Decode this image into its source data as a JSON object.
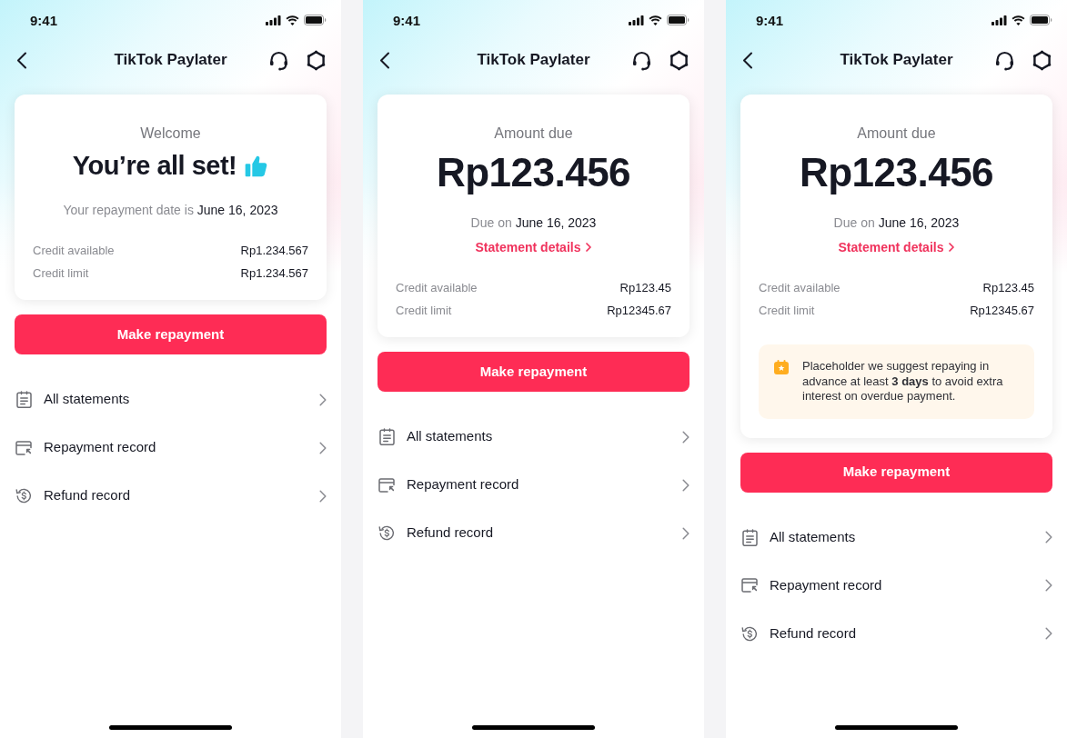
{
  "screens": [
    {
      "status_bar": {
        "time": "9:41"
      },
      "header": {
        "title": "TikTok Paylater"
      },
      "summary_card": {
        "kind": "welcome",
        "eyebrow": "Welcome",
        "headline": "You’re all set!",
        "date_label": "Your repayment date is",
        "date": "June 16, 2023",
        "rows": [
          {
            "label": "Credit available",
            "value": "Rp1.234.567"
          },
          {
            "label": "Credit limit",
            "value": "Rp1.234.567"
          }
        ]
      },
      "primary_button": "Make repayment",
      "menu": [
        {
          "kind": "statements",
          "label": "All statements"
        },
        {
          "kind": "repayment",
          "label": "Repayment record"
        },
        {
          "kind": "refund",
          "label": "Refund record"
        }
      ]
    },
    {
      "status_bar": {
        "time": "9:41"
      },
      "header": {
        "title": "TikTok Paylater"
      },
      "summary_card": {
        "kind": "amount_due",
        "eyebrow": "Amount due",
        "amount": "Rp123.456",
        "date_label": "Due on",
        "date": "June 16, 2023",
        "link": "Statement details",
        "rows": [
          {
            "label": "Credit available",
            "value": "Rp123.45"
          },
          {
            "label": "Credit limit",
            "value": "Rp12345.67"
          }
        ]
      },
      "primary_button": "Make repayment",
      "menu": [
        {
          "kind": "statements",
          "label": "All statements"
        },
        {
          "kind": "repayment",
          "label": "Repayment record"
        },
        {
          "kind": "refund",
          "label": "Refund record"
        }
      ]
    },
    {
      "status_bar": {
        "time": "9:41"
      },
      "header": {
        "title": "TikTok Paylater"
      },
      "summary_card": {
        "kind": "amount_due",
        "eyebrow": "Amount due",
        "amount": "Rp123.456",
        "date_label": "Due on",
        "date": "June 16, 2023",
        "link": "Statement details",
        "rows": [
          {
            "label": "Credit available",
            "value": "Rp123.45"
          },
          {
            "label": "Credit limit",
            "value": "Rp12345.67"
          }
        ],
        "notice": "Placeholder we suggest repaying in advance at least **3 days** to avoid extra interest on overdue payment."
      },
      "primary_button": "Make repayment",
      "menu": [
        {
          "kind": "statements",
          "label": "All statements"
        },
        {
          "kind": "repayment",
          "label": "Repayment record"
        },
        {
          "kind": "refund",
          "label": "Refund record"
        }
      ]
    }
  ]
}
